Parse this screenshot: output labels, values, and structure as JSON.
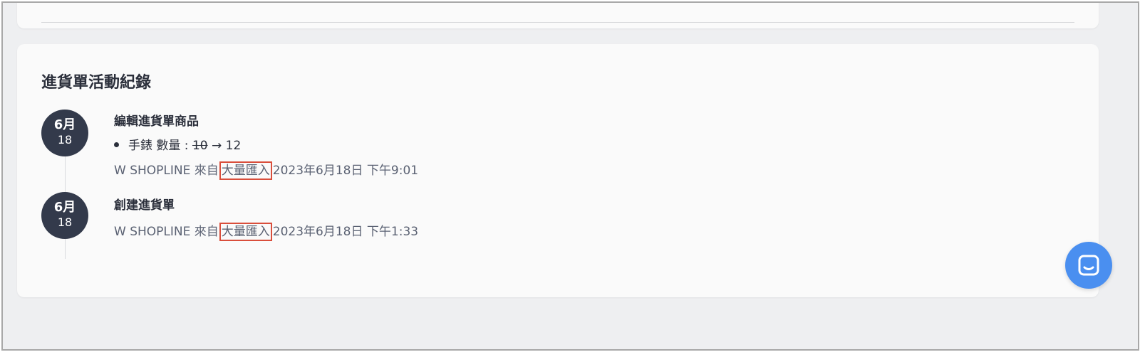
{
  "activity_log": {
    "title": "進貨單活動紀錄",
    "entries": [
      {
        "date_month": "6月",
        "date_day": "18",
        "action": "編輯進貨單商品",
        "change": {
          "item_label": "手錶 數量 :",
          "old_value": "10",
          "arrow": "→",
          "new_value": "12"
        },
        "user_prefix": "W SHOPLINE 來自",
        "source": "大量匯入",
        "timestamp": "2023年6月18日 下午9:01"
      },
      {
        "date_month": "6月",
        "date_day": "18",
        "action": "創建進貨單",
        "user_prefix": "W SHOPLINE 來自",
        "source": "大量匯入",
        "timestamp": "2023年6月18日 下午1:33"
      }
    ]
  },
  "chat_widget": {
    "icon": "chat-bubble-icon",
    "color": "#4a8ff0"
  },
  "colors": {
    "badge_bg": "#333a4b",
    "highlight_border": "#d94e3b",
    "page_bg": "#eeeff1",
    "card_bg": "#fafafa"
  }
}
